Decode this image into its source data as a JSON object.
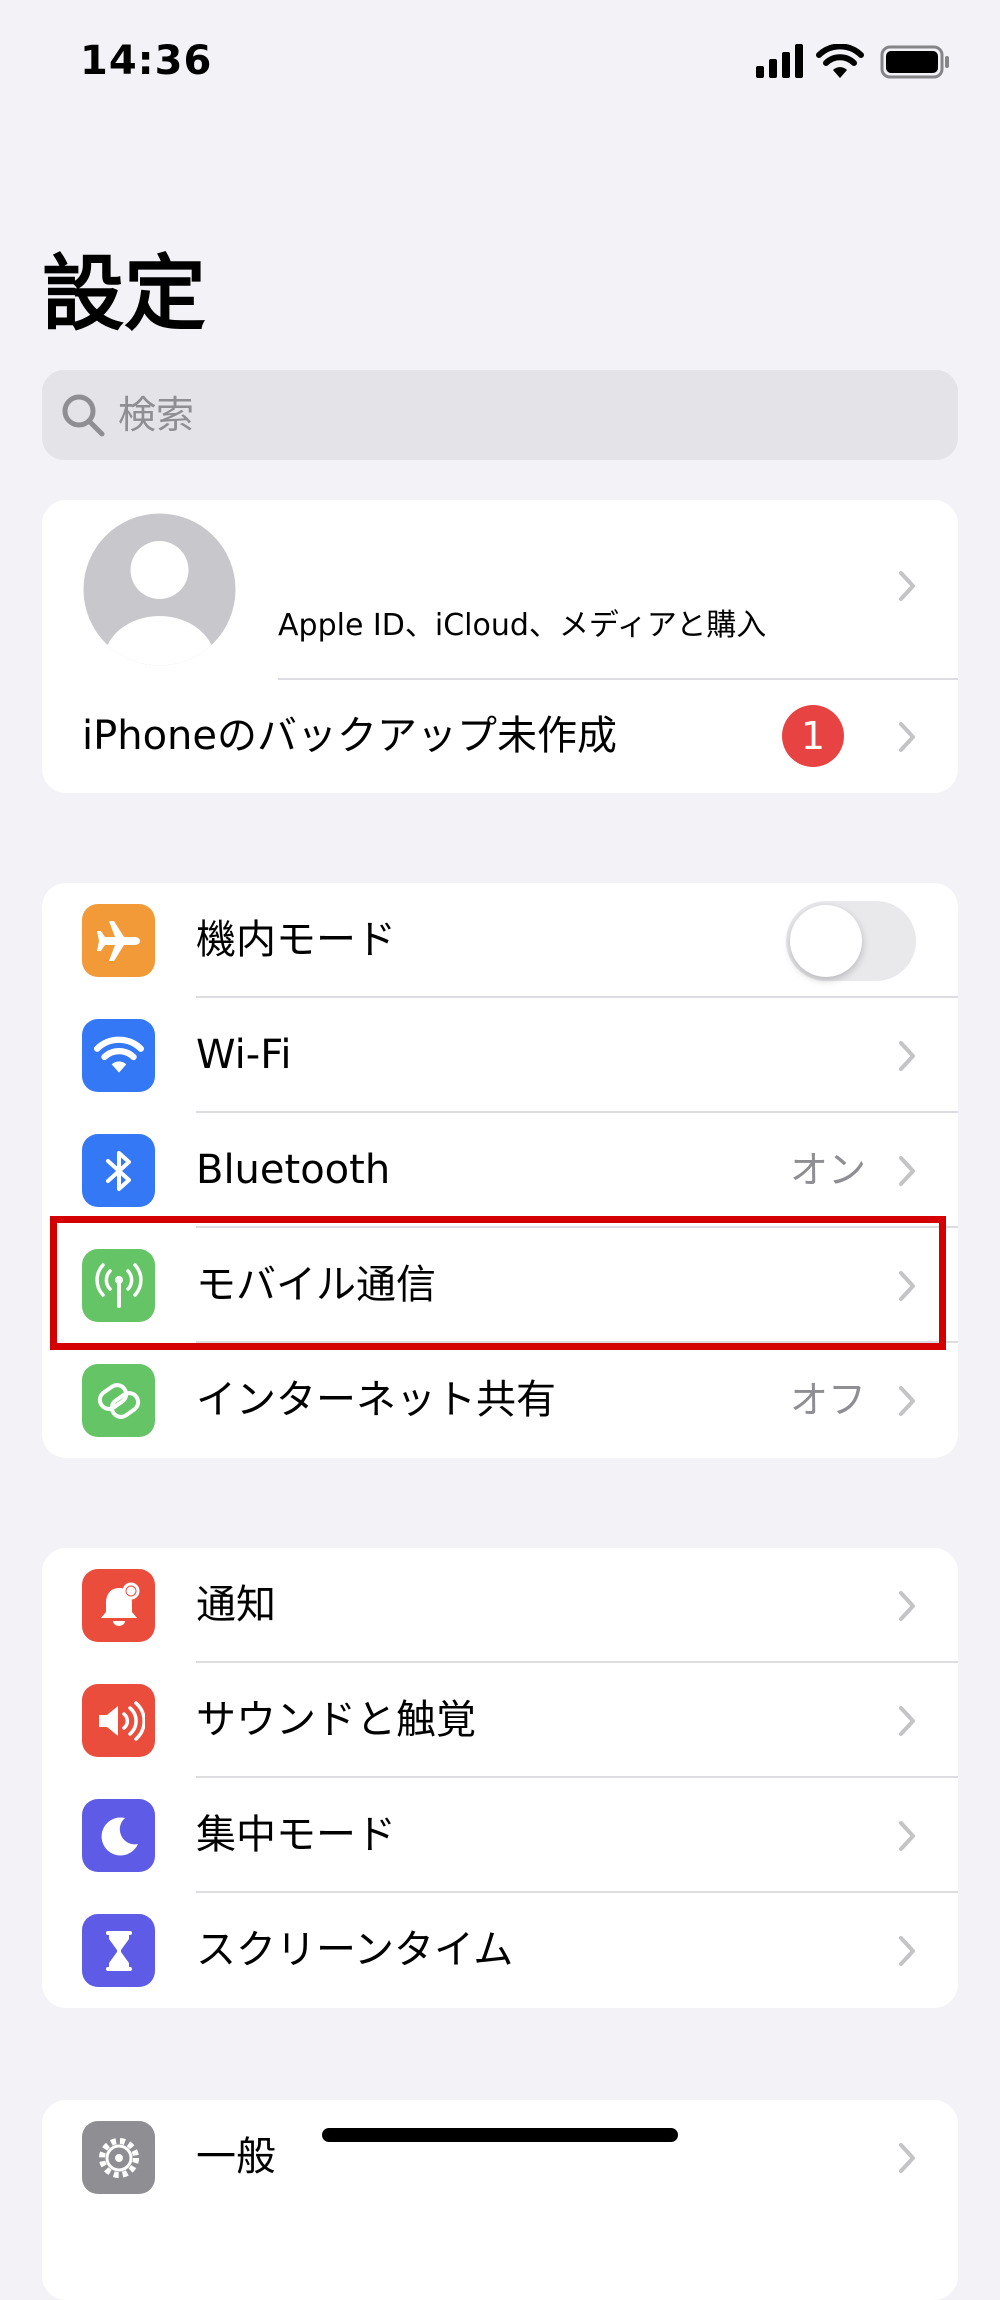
{
  "status_bar": {
    "time": "14:36",
    "icons": [
      "cellular-signal-icon",
      "wifi-icon",
      "battery-icon"
    ]
  },
  "page": {
    "title": "設定"
  },
  "search": {
    "placeholder": "検索",
    "icon": "magnifier-icon"
  },
  "profile": {
    "subtitle": "Apple ID、iCloud、メディアと購入",
    "backup_label": "iPhoneのバックアップ未作成",
    "badge": "1"
  },
  "connectivity": {
    "airplane": {
      "label": "機内モード",
      "toggle_on": false,
      "icon": "airplane-icon",
      "color": "#f19a37"
    },
    "wifi": {
      "label": "Wi-Fi",
      "icon": "wifi-icon",
      "color": "#3478f6"
    },
    "bluetooth": {
      "label": "Bluetooth",
      "value": "オン",
      "icon": "bluetooth-icon",
      "color": "#3478f6"
    },
    "cellular": {
      "label": "モバイル通信",
      "icon": "antenna-icon",
      "color": "#65c466"
    },
    "hotspot": {
      "label": "インターネット共有",
      "value": "オフ",
      "icon": "hotspot-link-icon",
      "color": "#65c466"
    }
  },
  "notifications_group": {
    "notifications": {
      "label": "通知",
      "icon": "bell-icon",
      "color": "#eb4d3d"
    },
    "sounds": {
      "label": "サウンドと触覚",
      "icon": "speaker-icon",
      "color": "#eb4d3d"
    },
    "focus": {
      "label": "集中モード",
      "icon": "moon-icon",
      "color": "#5e5ce6"
    },
    "screen_time": {
      "label": "スクリーンタイム",
      "icon": "hourglass-icon",
      "color": "#5e5ce6"
    }
  },
  "general_group": {
    "general": {
      "label": "一般",
      "icon": "gear-icon",
      "color": "#8e8e93"
    }
  }
}
